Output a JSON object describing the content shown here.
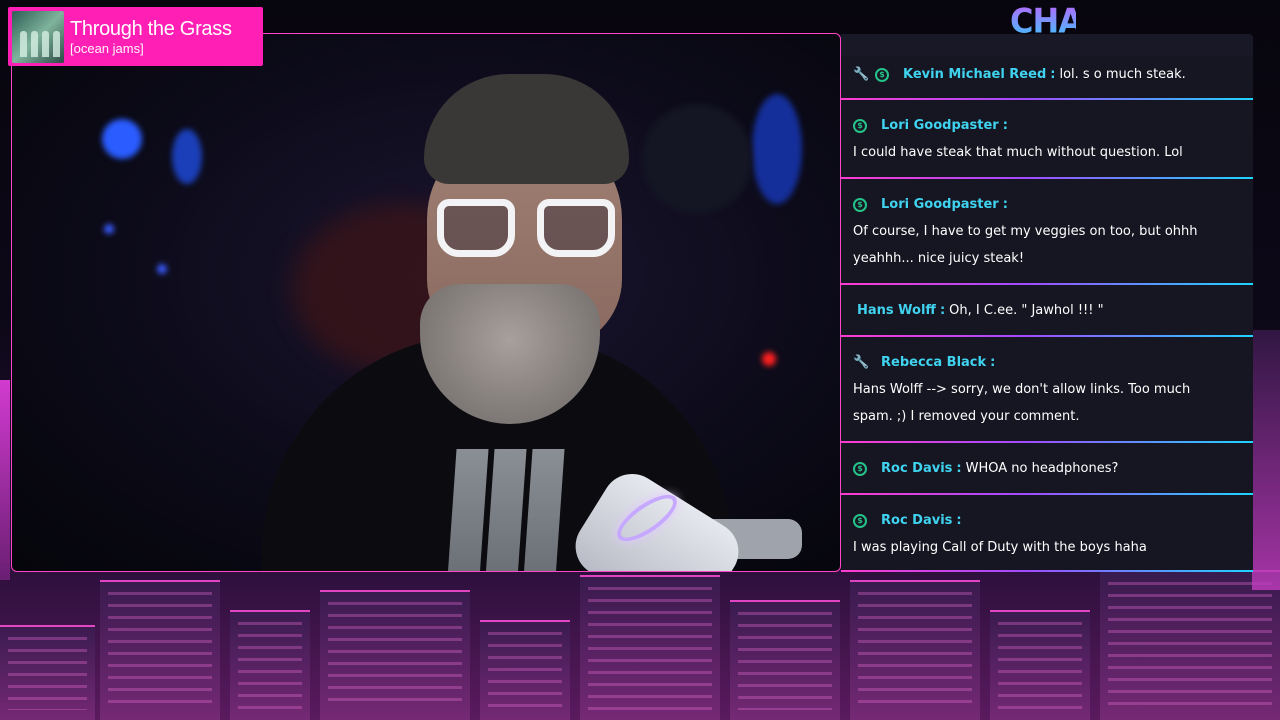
{
  "now_playing": {
    "title": "Through the Grass",
    "subtitle": "[ocean jams]",
    "album_art_icon": "album-art-image"
  },
  "chat": {
    "heading": "CHAT",
    "messages": [
      {
        "user": "Kevin Michael Reed",
        "badges": [
          "wrench-icon",
          "money-icon"
        ],
        "separator": ":",
        "inline_text": "lol. s o much steak.",
        "lines": []
      },
      {
        "user": "Lori Goodpaster",
        "badges": [
          "money-icon"
        ],
        "separator": ":",
        "inline_text": "",
        "lines": [
          "I could have steak that much without question. Lol"
        ]
      },
      {
        "user": "Lori Goodpaster",
        "badges": [
          "money-icon"
        ],
        "separator": ":",
        "inline_text": "",
        "lines": [
          "Of course, I have to get my veggies on too, but ohhh",
          "yeahhh... nice juicy steak!"
        ]
      },
      {
        "user": "Hans Wolff",
        "badges": [],
        "separator": ":",
        "inline_text": "Oh, I C.ee. \" Jawhol !!! \"",
        "lines": []
      },
      {
        "user": "Rebecca Black",
        "badges": [
          "wrench-icon"
        ],
        "separator": ":",
        "inline_text": "",
        "lines": [
          "Hans Wolff --> sorry, we don't allow links. Too much",
          "spam. ;) I removed your comment."
        ]
      },
      {
        "user": "Roc Davis",
        "badges": [
          "money-icon"
        ],
        "separator": ":",
        "inline_text": "WHOA no headphones?",
        "lines": []
      },
      {
        "user": "Roc Davis",
        "badges": [
          "money-icon"
        ],
        "separator": ":",
        "inline_text": "",
        "lines": [
          "I was playing Call of Duty with the boys haha"
        ]
      }
    ]
  },
  "colors": {
    "accent_pink": "#ff1fb4",
    "username_cyan": "#3fd3f0",
    "mod_blue": "#4a9cff",
    "member_green": "#25c38a"
  }
}
